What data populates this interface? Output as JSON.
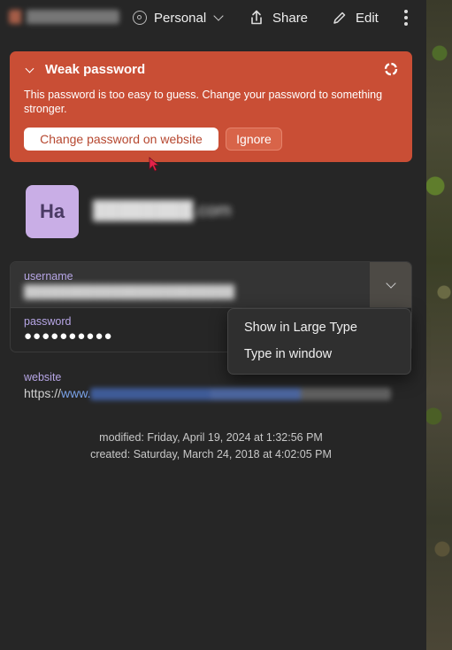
{
  "header": {
    "vault": "Personal",
    "share_label": "Share",
    "edit_label": "Edit"
  },
  "warning": {
    "title": "Weak password",
    "message": "This password is too easy to guess. Change your password to something stronger.",
    "change_button": "Change password on website",
    "ignore_button": "Ignore",
    "color": "#c94e35"
  },
  "item": {
    "initials": "Ha",
    "avatar_color": "#c9aee6"
  },
  "fields": {
    "username_label": "username",
    "password_label": "password",
    "password_value": "●●●●●●●●●●",
    "website_label": "website",
    "website_prefix": "https://",
    "website_link_start": "www."
  },
  "menu": {
    "items": [
      "Show in Large Type",
      "Type in window"
    ]
  },
  "meta": {
    "modified": "modified: Friday, April 19, 2024 at 1:32:56 PM",
    "created": "created: Saturday, March 24, 2018 at 4:02:05 PM"
  }
}
